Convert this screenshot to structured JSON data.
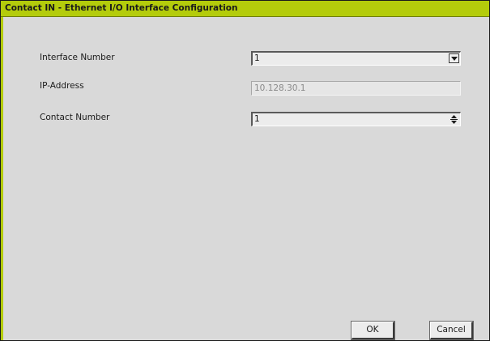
{
  "dialog": {
    "title": "Contact IN - Ethernet I/O Interface Configuration"
  },
  "form": {
    "interface_number": {
      "label": "Interface Number",
      "value": "1",
      "icon": "chevron-down-icon"
    },
    "ip_address": {
      "label": "IP-Address",
      "value": "10.128.30.1"
    },
    "contact_number": {
      "label": "Contact Number",
      "value": "1",
      "icon": "spinner-arrows-icon"
    }
  },
  "buttons": {
    "ok": "OK",
    "cancel": "Cancel"
  },
  "colors": {
    "title_bar": "#b4cc0b",
    "background": "#d9d9d9"
  }
}
